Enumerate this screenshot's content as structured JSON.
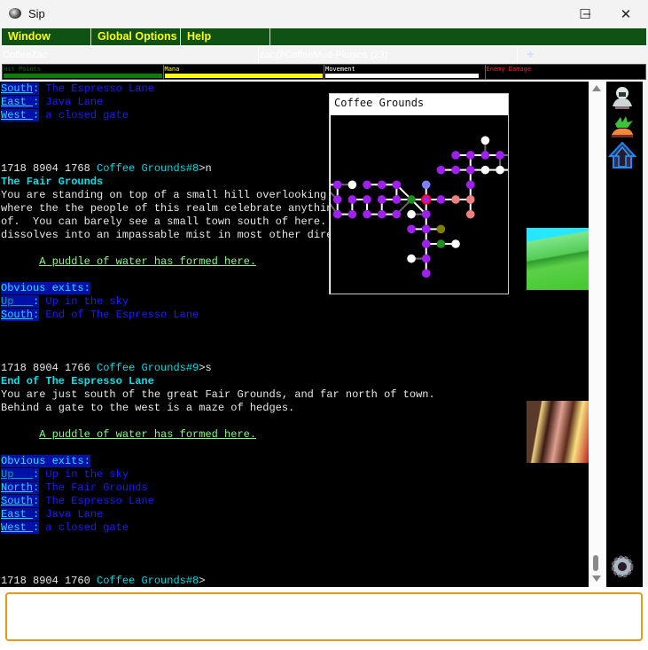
{
  "window": {
    "title": "Sip",
    "minimize": "–",
    "maximize": "☐",
    "close": "✕"
  },
  "menu": [
    "Window",
    "Global Options",
    "Help"
  ],
  "tabs": [
    {
      "label": "CoffeeZac",
      "color": "#ff5b5b"
    },
    {
      "label": "zac@CoffeeMud-Plugins (23)",
      "color": "#0a7d0a"
    },
    {
      "label": "+",
      "color": "#000000"
    }
  ],
  "status": [
    {
      "label": "Hit Points",
      "color": "#0a6a0a",
      "bar_color": "#0a7d0a",
      "fill_pct": 100
    },
    {
      "label": "Mana",
      "color": "#ffff00",
      "bar_color": "#ffff00",
      "fill_pct": 100
    },
    {
      "label": "Movement",
      "color": "#ffffff",
      "bar_color": "#ffffff",
      "fill_pct": 97
    },
    {
      "label": "Enemy Damage",
      "color": "#ff2020",
      "bar_color": "#ff2020",
      "fill_pct": 0
    }
  ],
  "output": {
    "lines": [
      [
        {
          "t": "dir",
          "text": "South"
        },
        {
          "t": "colon",
          "text": ":"
        },
        {
          "t": "desc",
          "text": " The Espresso Lane"
        }
      ],
      [
        {
          "t": "dir",
          "text": "East "
        },
        {
          "t": "colon",
          "text": ":"
        },
        {
          "t": "desc",
          "text": " Java Lane"
        }
      ],
      [
        {
          "t": "dir",
          "text": "West "
        },
        {
          "t": "colon",
          "text": ":"
        },
        {
          "t": "desc",
          "text": " a closed gate"
        }
      ],
      [],
      [],
      [],
      [
        {
          "t": "plain",
          "text": "1718 8904 1768 "
        },
        {
          "t": "room",
          "text": "Coffee Grounds#8"
        },
        {
          "t": "plain",
          "text": ">n"
        }
      ],
      [
        {
          "t": "title",
          "text": "The Fair Grounds"
        }
      ],
      [
        {
          "t": "plain",
          "text": "You are standing on top of a small hill overlooking"
        }
      ],
      [
        {
          "t": "plain",
          "text": "where the the people of this realm celebrate anythin"
        }
      ],
      [
        {
          "t": "plain",
          "text": "of.  You can barely see a small town south of here."
        }
      ],
      [
        {
          "t": "plain",
          "text": "dissolves into an impassable mist in most other dire"
        }
      ],
      [],
      [
        {
          "t": "plain",
          "text": "      "
        },
        {
          "t": "item",
          "text": "A puddle of water has formed here."
        }
      ],
      [],
      [
        {
          "t": "exith",
          "text": "Obvious exits:"
        }
      ],
      [
        {
          "t": "dirv",
          "text": "Up   "
        },
        {
          "t": "colon",
          "text": ":"
        },
        {
          "t": "desc",
          "text": " Up in the sky"
        }
      ],
      [
        {
          "t": "dir",
          "text": "South"
        },
        {
          "t": "colon",
          "text": ":"
        },
        {
          "t": "desc",
          "text": " End of The Espresso Lane"
        }
      ],
      [],
      [],
      [],
      [
        {
          "t": "plain",
          "text": "1718 8904 1766 "
        },
        {
          "t": "room",
          "text": "Coffee Grounds#9"
        },
        {
          "t": "plain",
          "text": ">s"
        }
      ],
      [
        {
          "t": "title",
          "text": "End of The Espresso Lane"
        }
      ],
      [
        {
          "t": "plain",
          "text": "You are just south of the great Fair Grounds, and far north of town."
        }
      ],
      [
        {
          "t": "plain",
          "text": "Behind a gate to the west is a maze of hedges."
        }
      ],
      [],
      [
        {
          "t": "plain",
          "text": "      "
        },
        {
          "t": "item",
          "text": "A puddle of water has formed here."
        }
      ],
      [],
      [
        {
          "t": "exith",
          "text": "Obvious exits:"
        }
      ],
      [
        {
          "t": "dirv",
          "text": "Up   "
        },
        {
          "t": "colon",
          "text": ":"
        },
        {
          "t": "desc",
          "text": " Up in the sky"
        }
      ],
      [
        {
          "t": "dir",
          "text": "North"
        },
        {
          "t": "colon",
          "text": ":"
        },
        {
          "t": "desc",
          "text": " The Fair Grounds"
        }
      ],
      [
        {
          "t": "dir",
          "text": "South"
        },
        {
          "t": "colon",
          "text": ":"
        },
        {
          "t": "desc",
          "text": " The Espresso Lane"
        }
      ],
      [
        {
          "t": "dir",
          "text": "East "
        },
        {
          "t": "colon",
          "text": ":"
        },
        {
          "t": "desc",
          "text": " Java Lane"
        }
      ],
      [
        {
          "t": "dir",
          "text": "West "
        },
        {
          "t": "colon",
          "text": ":"
        },
        {
          "t": "desc",
          "text": " a closed gate"
        }
      ],
      [],
      [],
      [],
      [
        {
          "t": "plain",
          "text": "1718 8904 1760 "
        },
        {
          "t": "room",
          "text": "Coffee Grounds#8"
        },
        {
          "t": "plain",
          "text": ">"
        }
      ]
    ]
  },
  "map": {
    "title": "Coffee Grounds",
    "colors": {
      "room": "#a020f0",
      "unexplored": "#ffffff",
      "current_ring": "#ff0000",
      "shop": "#f08080",
      "exit_room": "#228b22",
      "special": "#808000",
      "up": "#8080ff"
    }
  },
  "side_icons": [
    "ghost-icon",
    "plant-icon",
    "portal-icon",
    "settings-gear-icon"
  ],
  "input": {
    "value": ""
  }
}
